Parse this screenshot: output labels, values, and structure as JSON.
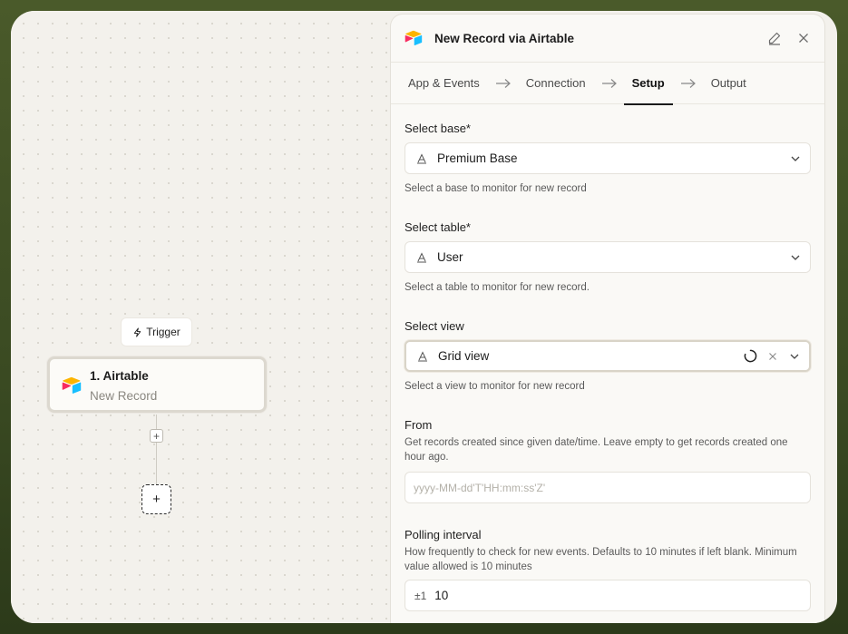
{
  "canvas": {
    "trigger_label": "Trigger",
    "node": {
      "title": "1. Airtable",
      "subtitle": "New Record"
    },
    "add_step_small": "+",
    "add_step_big": "+"
  },
  "panel": {
    "title": "New Record via Airtable",
    "tabs": [
      {
        "label": "App & Events",
        "active": false
      },
      {
        "label": "Connection",
        "active": false
      },
      {
        "label": "Setup",
        "active": true
      },
      {
        "label": "Output",
        "active": false
      }
    ],
    "fields": {
      "base": {
        "label": "Select base*",
        "value": "Premium Base",
        "help": "Select a base to monitor for new record"
      },
      "table": {
        "label": "Select table*",
        "value": "User",
        "help": "Select a table to monitor for new record."
      },
      "view": {
        "label": "Select view",
        "value": "Grid view",
        "help": "Select a view to monitor for new record"
      },
      "from": {
        "label": "From",
        "help": "Get records created since given date/time. Leave empty to get records created one hour ago.",
        "placeholder": "yyyy-MM-dd'T'HH:mm:ss'Z'"
      },
      "polling": {
        "label": "Polling interval",
        "help": "How frequently to check for new events. Defaults to 10 minutes if left blank. Minimum value allowed is 10 minutes",
        "prefix": "±1",
        "value": "10"
      }
    }
  },
  "icons": {
    "logo": "airtable-logo-icon",
    "edit": "pencil-icon",
    "close": "close-icon",
    "arrow": "arrow-right-icon",
    "type": "text-type-icon",
    "chevron": "chevron-down-icon",
    "spinner": "loading-spinner-icon",
    "clear": "clear-icon",
    "bolt": "lightning-icon"
  },
  "colors": {
    "airtable_yellow": "#fcb400",
    "airtable_red": "#f82b60",
    "airtable_blue": "#18bfff"
  }
}
